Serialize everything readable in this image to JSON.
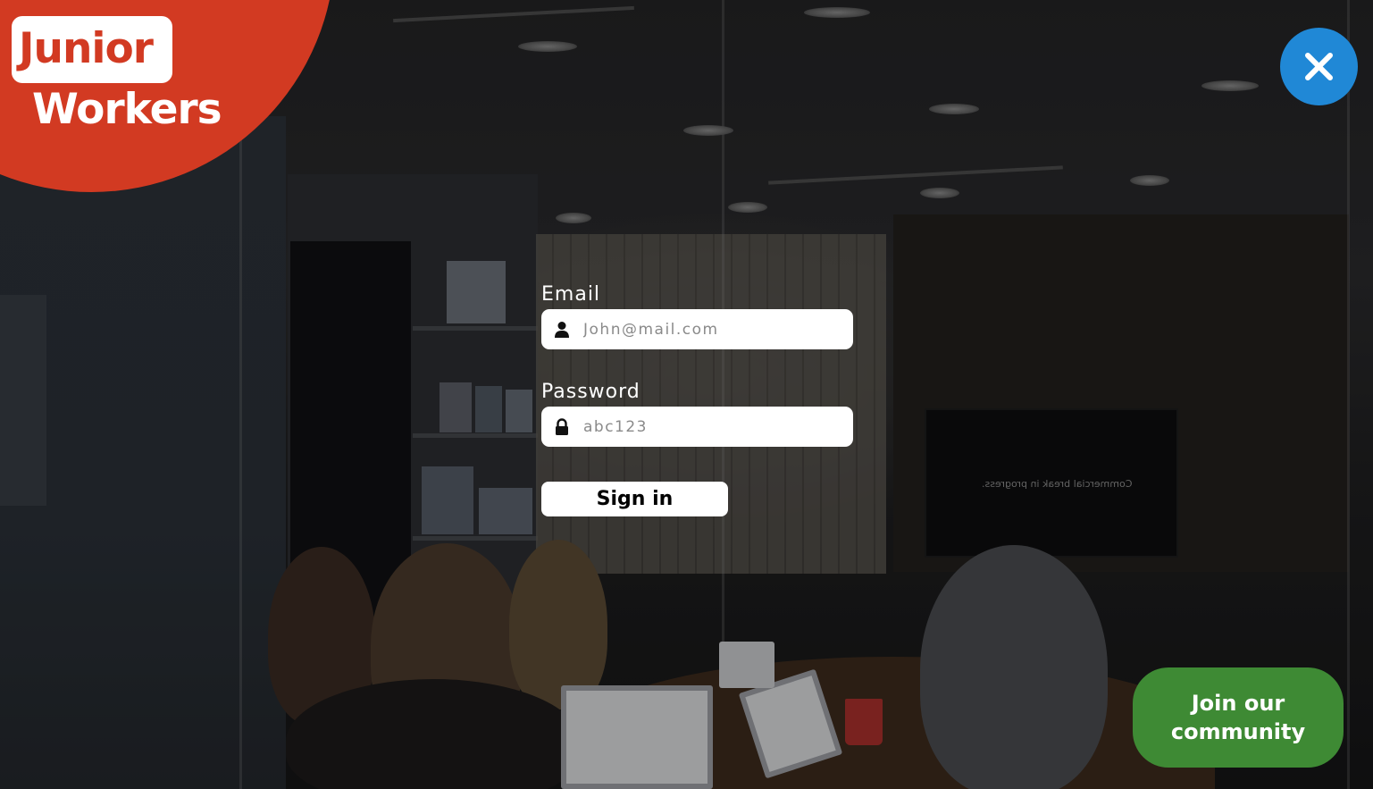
{
  "brand": {
    "line1": "Junior",
    "line2": "Workers",
    "primary_color": "#d23a22"
  },
  "close_button": {
    "icon": "close-icon",
    "color": "#2088d6"
  },
  "login_form": {
    "email_label": "Email",
    "email_placeholder": "John@mail.com",
    "email_icon": "user-icon",
    "password_label": "Password",
    "password_placeholder": "abc123",
    "password_icon": "lock-icon",
    "submit_label": "Sign in"
  },
  "community_cta": {
    "line1": "Join our",
    "line2": "community",
    "color": "#3e8a34"
  },
  "background": {
    "tv_caption": "Commercial break in progress."
  }
}
